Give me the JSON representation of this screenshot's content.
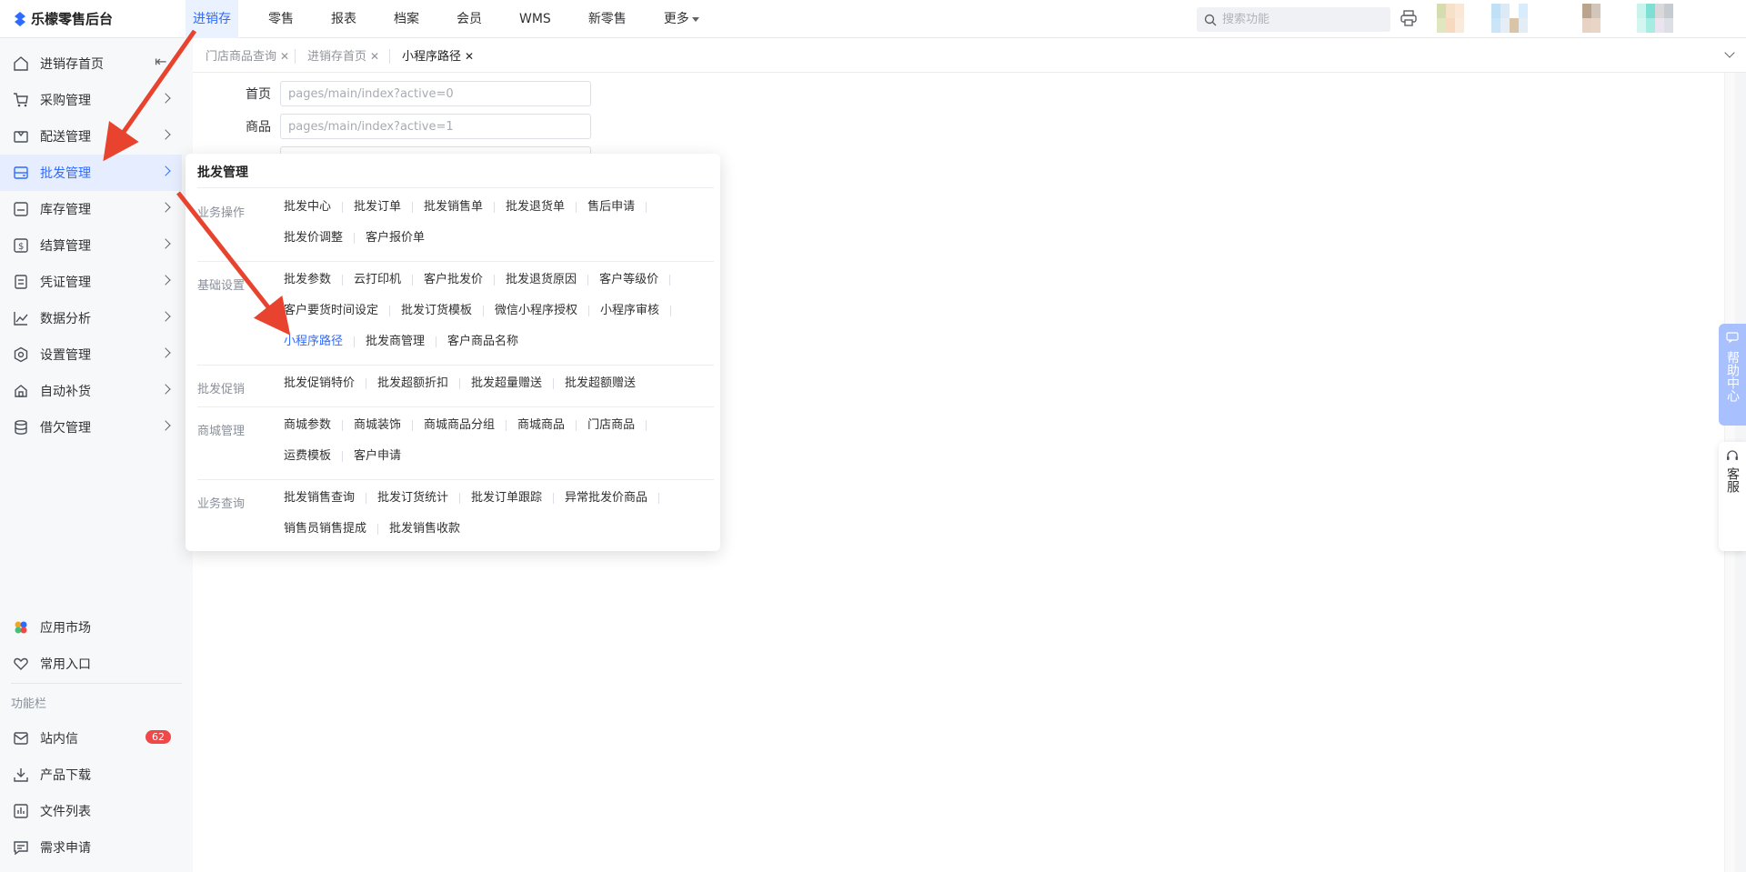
{
  "app": {
    "title": "乐檬零售后台"
  },
  "nav": {
    "items": [
      {
        "label": "进销存",
        "active": true
      },
      {
        "label": "零售"
      },
      {
        "label": "报表"
      },
      {
        "label": "档案"
      },
      {
        "label": "会员"
      },
      {
        "label": "WMS"
      },
      {
        "label": "新零售"
      },
      {
        "label": "更多"
      }
    ]
  },
  "search": {
    "placeholder": "搜索功能"
  },
  "sidebar": {
    "items": [
      {
        "label": "进销存首页",
        "icon": "home-icon"
      },
      {
        "label": "采购管理",
        "icon": "cart-icon"
      },
      {
        "label": "配送管理",
        "icon": "delivery-icon"
      },
      {
        "label": "批发管理",
        "icon": "wholesale-icon",
        "active": true
      },
      {
        "label": "库存管理",
        "icon": "inventory-icon"
      },
      {
        "label": "结算管理",
        "icon": "settlement-icon"
      },
      {
        "label": "凭证管理",
        "icon": "voucher-icon"
      },
      {
        "label": "数据分析",
        "icon": "chart-icon"
      },
      {
        "label": "设置管理",
        "icon": "settings-icon"
      },
      {
        "label": "自动补货",
        "icon": "restock-icon"
      },
      {
        "label": "借欠管理",
        "icon": "database-icon"
      }
    ],
    "bottom": [
      {
        "label": "应用市场",
        "icon": "app-market-icon"
      },
      {
        "label": "常用入口",
        "icon": "heart-icon"
      }
    ],
    "function_caption": "功能栏",
    "function_items": [
      {
        "label": "站内信",
        "icon": "mail-icon",
        "badge": "62"
      },
      {
        "label": "产品下载",
        "icon": "download-icon"
      },
      {
        "label": "文件列表",
        "icon": "file-list-icon"
      },
      {
        "label": "需求申请",
        "icon": "request-icon"
      }
    ]
  },
  "tabs": [
    {
      "label": "门店商品查询"
    },
    {
      "label": "进销存首页"
    },
    {
      "label": "小程序路径",
      "active": true
    }
  ],
  "form": {
    "rows": [
      {
        "label": "首页",
        "placeholder": "pages/main/index?active=0"
      },
      {
        "label": "商品",
        "placeholder": "pages/main/index?active=1"
      }
    ]
  },
  "popup": {
    "title": "批发管理",
    "sections": [
      {
        "label": "业务操作",
        "links": [
          "批发中心",
          "批发订单",
          "批发销售单",
          "批发退货单",
          "售后申请",
          "批发价调整",
          "客户报价单"
        ]
      },
      {
        "label": "基础设置",
        "links": [
          "批发参数",
          "云打印机",
          "客户批发价",
          "批发退货原因",
          "客户等级价",
          "客户要货时间设定",
          "批发订货模板",
          "微信小程序授权",
          "小程序审核",
          "小程序路径",
          "批发商管理",
          "客户商品名称"
        ],
        "active": "小程序路径"
      },
      {
        "label": "批发促销",
        "links": [
          "批发促销特价",
          "批发超额折扣",
          "批发超量赠送",
          "批发超额赠送"
        ]
      },
      {
        "label": "商城管理",
        "links": [
          "商城参数",
          "商城装饰",
          "商城商品分组",
          "商城商品",
          "门店商品",
          "运费模板",
          "客户申请"
        ]
      },
      {
        "label": "业务查询",
        "links": [
          "批发销售查询",
          "批发订货统计",
          "批发订单跟踪",
          "异常批发价商品",
          "销售员销售提成",
          "批发销售收款"
        ]
      }
    ]
  },
  "help": {
    "label": "帮助中心"
  },
  "customer_service": {
    "label": "客服"
  },
  "colors": {
    "accent": "#2f6bff",
    "arrow": "#e8432e",
    "badge": "#f04848"
  }
}
